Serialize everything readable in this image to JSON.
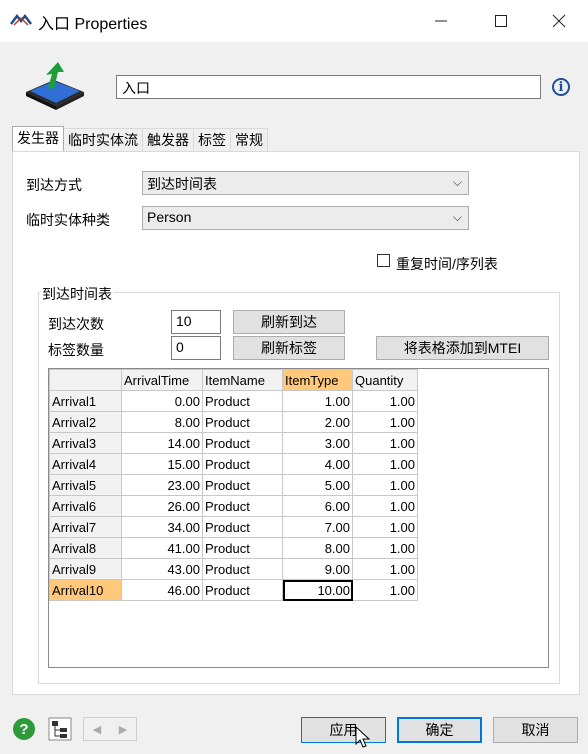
{
  "window": {
    "title": "入口 Properties"
  },
  "header": {
    "object_name": "入口"
  },
  "tabs": [
    "发生器",
    "临时实体流",
    "触发器",
    "标签",
    "常规"
  ],
  "form": {
    "arrival_style_label": "到达方式",
    "arrival_style_value": "到达时间表",
    "item_class_label": "临时实体种类",
    "item_class_value": "Person",
    "repeat_label": "重复时间/序列表"
  },
  "schedule": {
    "group_title": "到达时间表",
    "arrivals_label": "到达次数",
    "arrivals_value": "10",
    "labels_label": "标签数量",
    "labels_value": "0",
    "refresh_arrivals_btn": "刷新到达",
    "refresh_labels_btn": "刷新标签",
    "add_to_mtei_btn": "将表格添加到MTEI",
    "columns": [
      "ArrivalTime",
      "ItemName",
      "ItemType",
      "Quantity"
    ],
    "rows": [
      {
        "name": "Arrival1",
        "time": "0.00",
        "item": "Product",
        "type": "1.00",
        "qty": "1.00"
      },
      {
        "name": "Arrival2",
        "time": "8.00",
        "item": "Product",
        "type": "2.00",
        "qty": "1.00"
      },
      {
        "name": "Arrival3",
        "time": "14.00",
        "item": "Product",
        "type": "3.00",
        "qty": "1.00"
      },
      {
        "name": "Arrival4",
        "time": "15.00",
        "item": "Product",
        "type": "4.00",
        "qty": "1.00"
      },
      {
        "name": "Arrival5",
        "time": "23.00",
        "item": "Product",
        "type": "5.00",
        "qty": "1.00"
      },
      {
        "name": "Arrival6",
        "time": "26.00",
        "item": "Product",
        "type": "6.00",
        "qty": "1.00"
      },
      {
        "name": "Arrival7",
        "time": "34.00",
        "item": "Product",
        "type": "7.00",
        "qty": "1.00"
      },
      {
        "name": "Arrival8",
        "time": "41.00",
        "item": "Product",
        "type": "8.00",
        "qty": "1.00"
      },
      {
        "name": "Arrival9",
        "time": "43.00",
        "item": "Product",
        "type": "9.00",
        "qty": "1.00"
      },
      {
        "name": "Arrival10",
        "time": "46.00",
        "item": "Product",
        "type": "10.00",
        "qty": "1.00"
      }
    ]
  },
  "footer": {
    "apply": "应用",
    "ok": "确定",
    "cancel": "取消"
  }
}
